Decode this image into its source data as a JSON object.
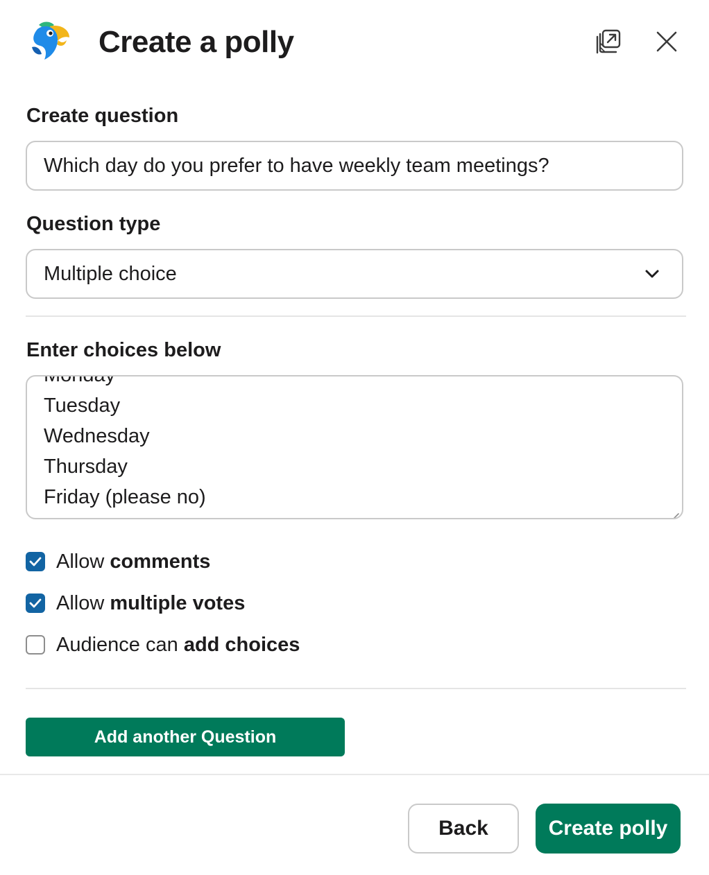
{
  "header": {
    "title": "Create a polly",
    "logo_icon": "polly-parrot-logo",
    "popout_icon": "popout-icon",
    "close_icon": "close-icon"
  },
  "question": {
    "label": "Create question",
    "value": "Which day do you prefer to have weekly team meetings?"
  },
  "question_type": {
    "label": "Question type",
    "selected": "Multiple choice",
    "icon": "chevron-down-icon"
  },
  "choices": {
    "label": "Enter choices below",
    "items": [
      "Monday",
      "Tuesday",
      "Wednesday",
      "Thursday",
      "Friday (please no)"
    ]
  },
  "options": [
    {
      "prefix": "Allow ",
      "bold": "comments",
      "checked": true
    },
    {
      "prefix": "Allow ",
      "bold": "multiple votes",
      "checked": true
    },
    {
      "prefix": "Audience can ",
      "bold": "add choices",
      "checked": false
    }
  ],
  "actions": {
    "add_question": "Add another Question",
    "back": "Back",
    "create": "Create polly"
  },
  "colors": {
    "primary": "#007a5a",
    "checkbox": "#1264a3"
  }
}
